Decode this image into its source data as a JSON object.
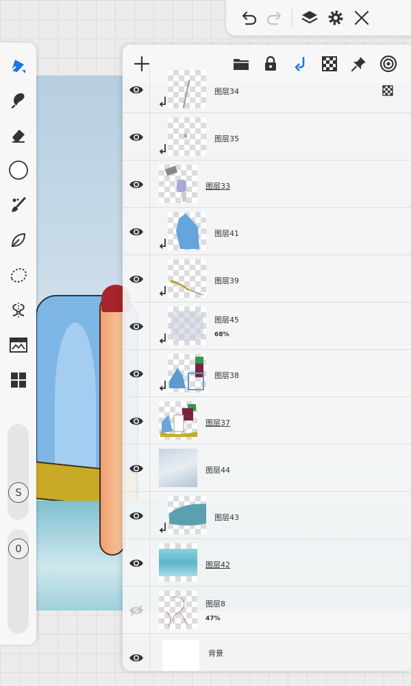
{
  "colors": {
    "accent": "#1677e5",
    "icon": "#333333",
    "panel_bg": "#f6f6f6"
  },
  "topbar": {
    "undo_icon": "undo-icon",
    "redo_icon": "redo-icon",
    "layers_icon": "layers-icon",
    "settings_icon": "gear-icon",
    "close_icon": "close-icon"
  },
  "sidebar": {
    "tools": [
      "pen-tool",
      "smudge-tool",
      "eraser-tool",
      "color-picker",
      "brush-tool",
      "leaf-tool",
      "lasso-tool",
      "symmetry-tool",
      "adjust-tool",
      "grid-tool"
    ],
    "size_badge": "S",
    "opacity_badge": "0"
  },
  "layers_panel": {
    "toolbar": {
      "add": "add-layer",
      "folder": "folder",
      "lock": "lock",
      "clip": "clipping-mask",
      "alpha": "alpha-lock",
      "pin": "pin",
      "reference": "reference"
    },
    "layers": [
      {
        "name": "图层34",
        "opacity": "",
        "clipped": true,
        "visible": true,
        "alpha_lock": true
      },
      {
        "name": "图层35",
        "opacity": "",
        "clipped": true,
        "visible": true
      },
      {
        "name": "图层33",
        "opacity": "",
        "clipped": false,
        "visible": true,
        "selected_underline": true
      },
      {
        "name": "图层41",
        "opacity": "",
        "clipped": true,
        "visible": true
      },
      {
        "name": "图层39",
        "opacity": "",
        "clipped": true,
        "visible": true
      },
      {
        "name": "图层45",
        "opacity": "68%",
        "clipped": true,
        "visible": true
      },
      {
        "name": "图层38",
        "opacity": "",
        "clipped": true,
        "visible": true
      },
      {
        "name": "图层37",
        "opacity": "",
        "clipped": false,
        "visible": true,
        "selected_underline": true
      },
      {
        "name": "图层44",
        "opacity": "",
        "clipped": false,
        "visible": true
      },
      {
        "name": "图层43",
        "opacity": "",
        "clipped": true,
        "visible": true
      },
      {
        "name": "图层42",
        "opacity": "",
        "clipped": false,
        "visible": true,
        "selected_underline": true
      },
      {
        "name": "图层8",
        "opacity": "47%",
        "clipped": false,
        "visible": false
      },
      {
        "name": "背景",
        "opacity": "",
        "clipped": false,
        "visible": true
      }
    ]
  }
}
